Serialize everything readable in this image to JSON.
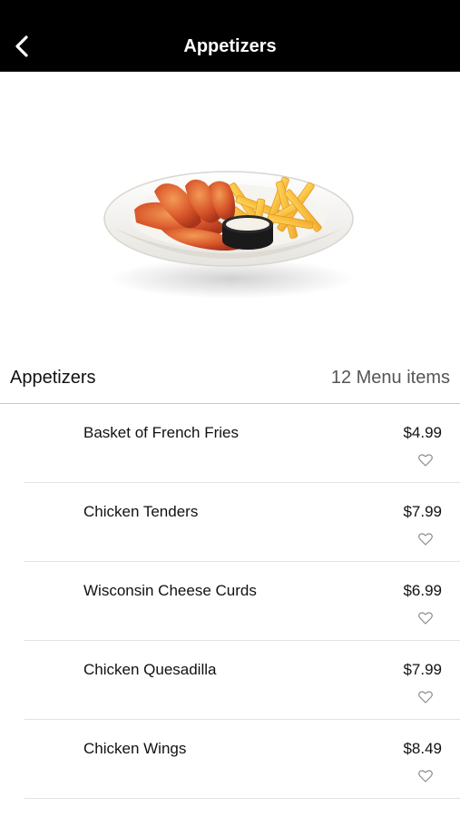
{
  "header": {
    "title": "Appetizers",
    "background_color": "#000000",
    "back_icon": "chevron-left-icon"
  },
  "hero": {
    "image": "plate-of-chicken-tenders-and-fries"
  },
  "section": {
    "title": "Appetizers",
    "count_label": "12 Menu items"
  },
  "menu": {
    "items": [
      {
        "name": "Basket of French Fries",
        "price": "$4.99",
        "favorite_icon": "heart-outline-icon"
      },
      {
        "name": "Chicken Tenders",
        "price": "$7.99",
        "favorite_icon": "heart-outline-icon"
      },
      {
        "name": "Wisconsin Cheese Curds",
        "price": "$6.99",
        "favorite_icon": "heart-outline-icon"
      },
      {
        "name": "Chicken Quesadilla",
        "price": "$7.99",
        "favorite_icon": "heart-outline-icon"
      },
      {
        "name": "Chicken Wings",
        "price": "$8.49",
        "favorite_icon": "heart-outline-icon"
      }
    ]
  }
}
